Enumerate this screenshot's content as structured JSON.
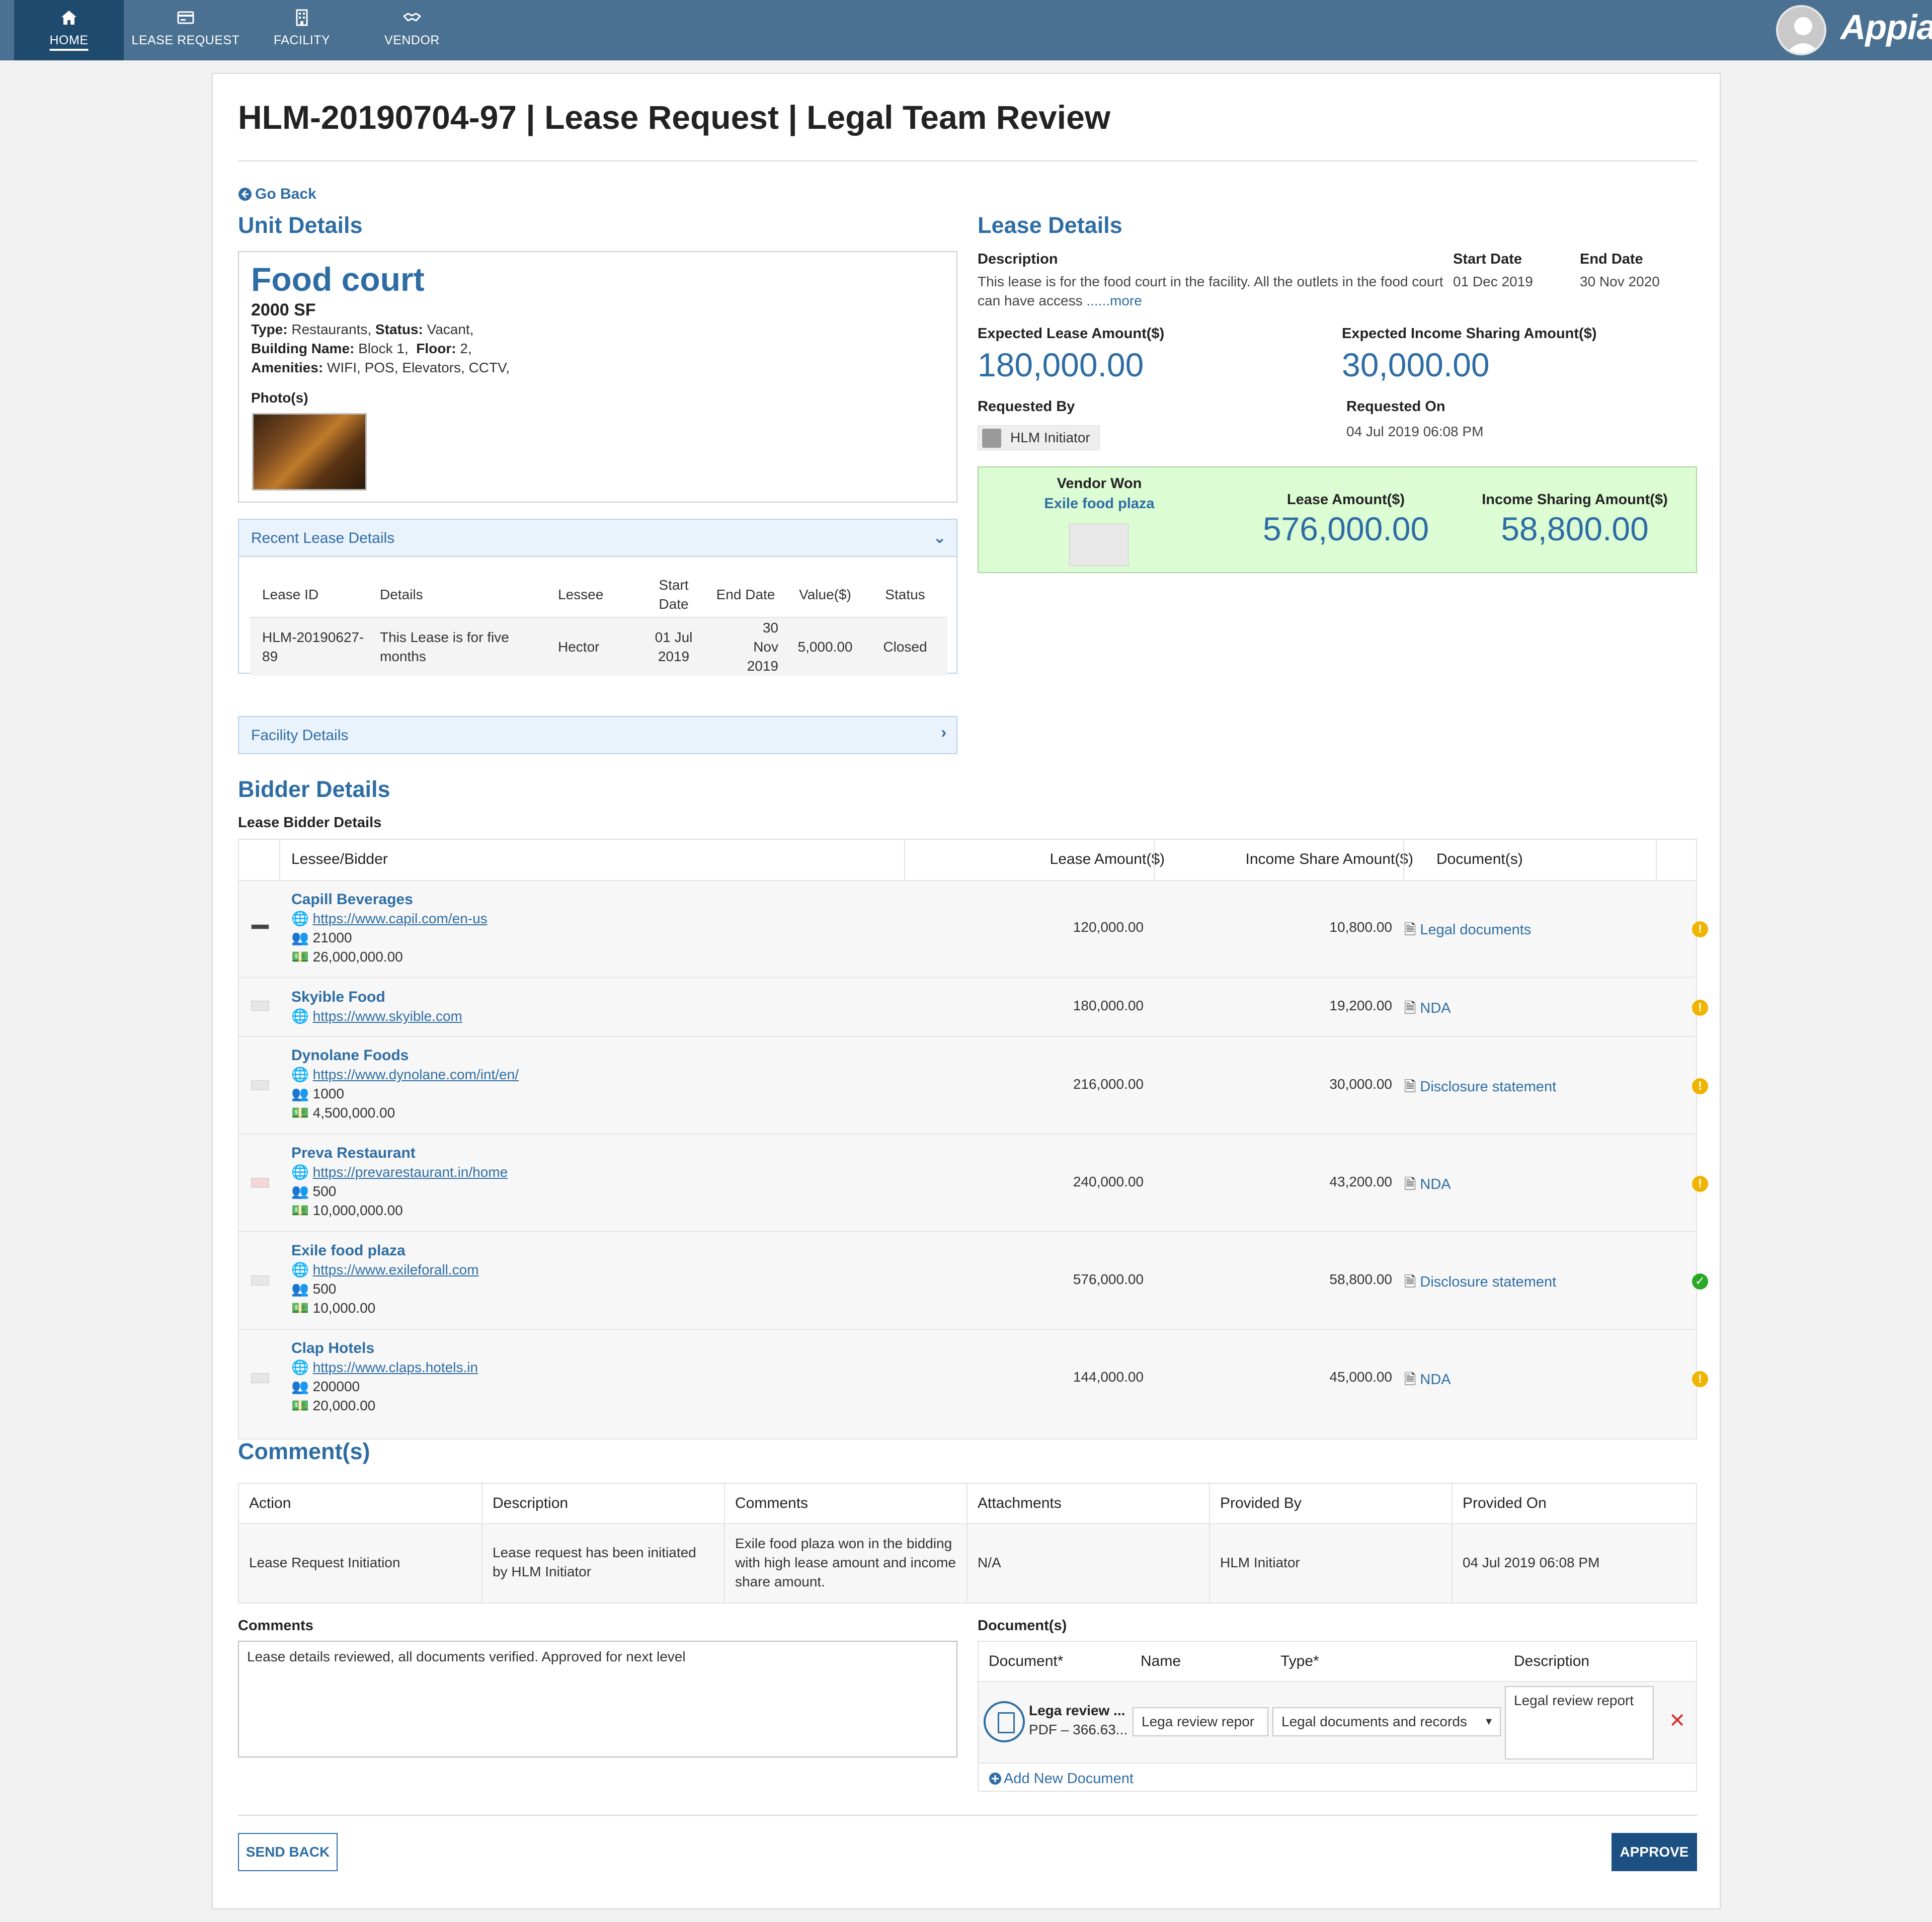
{
  "nav": {
    "items": [
      {
        "label": "HOME",
        "icon": "home-icon"
      },
      {
        "label": "LEASE REQUEST",
        "icon": "card-icon"
      },
      {
        "label": "FACILITY",
        "icon": "building-icon"
      },
      {
        "label": "VENDOR",
        "icon": "handshake-icon"
      }
    ],
    "active_index": 0,
    "brand": "Appian"
  },
  "page": {
    "title": "HLM-20190704-97 | Lease Request | Legal Team Review",
    "go_back": "Go Back"
  },
  "unit": {
    "section_title": "Unit Details",
    "name": "Food court",
    "size": "2000 SF",
    "type_label": "Type:",
    "type": "Restaurants,",
    "status_label": "Status:",
    "status": "Vacant,",
    "building_label": "Building Name:",
    "building": "Block 1,",
    "floor_label": "Floor:",
    "floor": "2,",
    "amenities_label": "Amenities:",
    "amenities": "WIFI, POS, Elevators, CCTV,",
    "photos_label": "Photo(s)"
  },
  "recent_lease": {
    "title": "Recent Lease Details",
    "headers": [
      "Lease ID",
      "Details",
      "Lessee",
      "Start Date",
      "End Date",
      "Value($)",
      "Status"
    ],
    "rows": [
      {
        "id": "HLM-20190627-89",
        "details": "This Lease is for five months",
        "lessee": "Hector",
        "start": "01 Jul 2019",
        "end": "30 Nov 2019",
        "value": "5,000.00",
        "status": "Closed"
      }
    ]
  },
  "facility": {
    "title": "Facility Details"
  },
  "lease": {
    "section_title": "Lease Details",
    "description_label": "Description",
    "description": "This lease is for the food court in the facility. All the outlets in the food court can have access",
    "more": "......more",
    "start_label": "Start Date",
    "start": "01 Dec 2019",
    "end_label": "End Date",
    "end": "30 Nov 2020",
    "expected_amount_label": "Expected Lease Amount($)",
    "expected_amount": "180,000.00",
    "expected_income_label": "Expected Income Sharing Amount($)",
    "expected_income": "30,000.00",
    "requested_by_label": "Requested By",
    "requested_by": "HLM Initiator",
    "requested_on_label": "Requested On",
    "requested_on": "04 Jul 2019 06:08 PM"
  },
  "vendor_won": {
    "label": "Vendor Won",
    "name": "Exile food plaza",
    "lease_amount_label": "Lease Amount($)",
    "lease_amount": "576,000.00",
    "income_label": "Income Sharing Amount($)",
    "income": "58,800.00"
  },
  "bidders": {
    "section_title": "Bidder Details",
    "table_title": "Lease Bidder Details",
    "headers": {
      "bidder": "Lessee/Bidder",
      "lease": "Lease Amount($)",
      "income": "Income Share Amount($)",
      "docs": "Document(s)"
    },
    "rows": [
      {
        "name": "Capill Beverages",
        "url": "https://www.capil.com/en-us",
        "employees": "21000",
        "revenue": "26,000,000.00",
        "lease": "120,000.00",
        "income": "10,800.00",
        "doc": "Legal documents",
        "status": "warning"
      },
      {
        "name": "Skyible Food",
        "url": "https://www.skyible.com",
        "employees": "",
        "revenue": "",
        "lease": "180,000.00",
        "income": "19,200.00",
        "doc": "NDA",
        "status": "warning"
      },
      {
        "name": "Dynolane Foods",
        "url": "https://www.dynolane.com/int/en/",
        "employees": "1000",
        "revenue": "4,500,000.00",
        "lease": "216,000.00",
        "income": "30,000.00",
        "doc": "Disclosure statement",
        "status": "warning"
      },
      {
        "name": "Preva Restaurant",
        "url": "https://prevarestaurant.in/home",
        "employees": "500",
        "revenue": "10,000,000.00",
        "lease": "240,000.00",
        "income": "43,200.00",
        "doc": "NDA",
        "status": "warning"
      },
      {
        "name": "Exile food plaza",
        "url": "https://www.exileforall.com",
        "employees": "500",
        "revenue": "10,000.00",
        "lease": "576,000.00",
        "income": "58,800.00",
        "doc": "Disclosure statement",
        "status": "ok"
      },
      {
        "name": "Clap Hotels",
        "url": "https://www.claps.hotels.in",
        "employees": "200000",
        "revenue": "20,000.00",
        "lease": "144,000.00",
        "income": "45,000.00",
        "doc": "NDA",
        "status": "warning"
      }
    ]
  },
  "comments": {
    "section_title": "Comment(s)",
    "headers": [
      "Action",
      "Description",
      "Comments",
      "Attachments",
      "Provided By",
      "Provided On"
    ],
    "row": {
      "action": "Lease Request Initiation",
      "description": "Lease request has been initiated by HLM Initiator",
      "comments": "Exile food plaza won in the bidding with high lease amount and income share amount.",
      "attachments": "N/A",
      "provided_by": "HLM Initiator",
      "provided_on": "04 Jul 2019 06:08 PM"
    }
  },
  "form": {
    "comments_label": "Comments",
    "comments_value": "Lease details reviewed, all documents verified. Approved for next level",
    "documents_label": "Document(s)",
    "doc_headers": [
      "Document*",
      "Name",
      "Type*",
      "Description"
    ],
    "doc_row": {
      "file_name": "Lega review ...",
      "file_meta": "PDF – 366.63...",
      "name": "Lega review repor",
      "type": "Legal documents and records",
      "description": "Legal review report"
    },
    "add_new": "Add New Document",
    "send_back": "SEND BACK",
    "approve": "APPROVE"
  },
  "colors": {
    "nav_bg": "#4b7192",
    "nav_active": "#1e4a6e",
    "accent": "#2e6da4",
    "winner_bg": "#dcfcd4",
    "warning": "#f0b400",
    "success": "#2aa82a",
    "danger": "#d9302c"
  }
}
